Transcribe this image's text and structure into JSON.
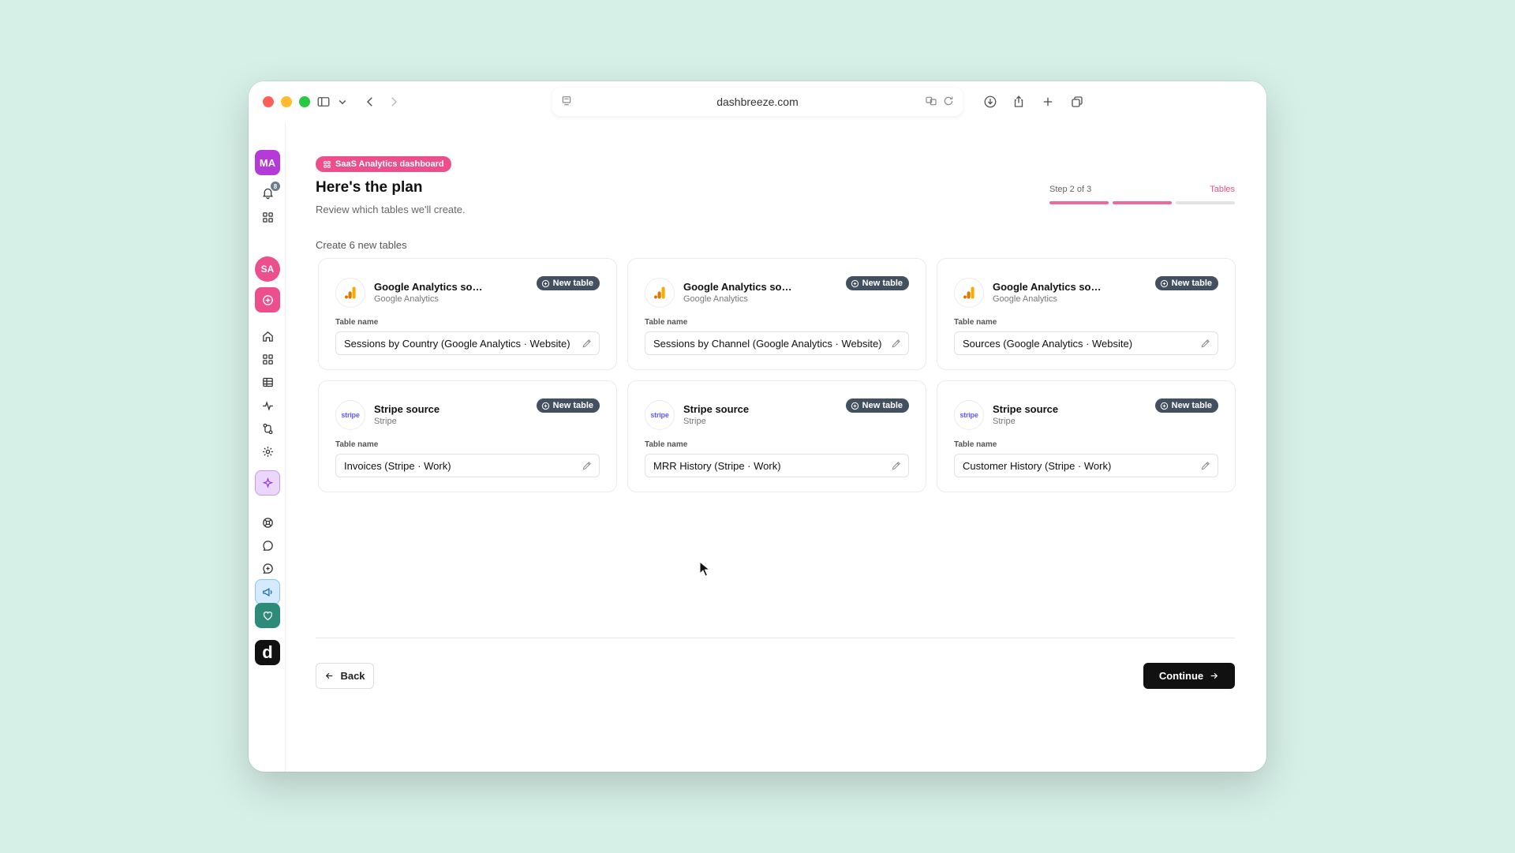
{
  "browser": {
    "url": "dashbreeze.com"
  },
  "sidebar": {
    "user_initials": "MA",
    "notification_count": "8",
    "workspace_initials": "SA",
    "logo_letter": "d"
  },
  "header": {
    "pill_label": "SaaS Analytics dashboard",
    "title": "Here's the plan",
    "subtitle": "Review which tables we'll create.",
    "step_text": "Step 2 of 3",
    "step_label": "Tables",
    "step_current": 2,
    "step_total": 3
  },
  "section_label": "Create 6 new tables",
  "cards": [
    {
      "source_title": "Google Analytics sour...",
      "source_type": "Google Analytics",
      "badge": "New table",
      "field_label": "Table name",
      "table_name": "Sessions by Country (Google Analytics · Website)",
      "logo": "google-analytics"
    },
    {
      "source_title": "Google Analytics sour...",
      "source_type": "Google Analytics",
      "badge": "New table",
      "field_label": "Table name",
      "table_name": "Sessions by Channel (Google Analytics · Website)",
      "logo": "google-analytics"
    },
    {
      "source_title": "Google Analytics sour...",
      "source_type": "Google Analytics",
      "badge": "New table",
      "field_label": "Table name",
      "table_name": "Sources (Google Analytics · Website)",
      "logo": "google-analytics"
    },
    {
      "source_title": "Stripe source",
      "source_type": "Stripe",
      "badge": "New table",
      "field_label": "Table name",
      "table_name": "Invoices (Stripe · Work)",
      "logo": "stripe",
      "logo_text": "stripe"
    },
    {
      "source_title": "Stripe source",
      "source_type": "Stripe",
      "badge": "New table",
      "field_label": "Table name",
      "table_name": "MRR History (Stripe · Work)",
      "logo": "stripe",
      "logo_text": "stripe"
    },
    {
      "source_title": "Stripe source",
      "source_type": "Stripe",
      "badge": "New table",
      "field_label": "Table name",
      "table_name": "Customer History (Stripe · Work)",
      "logo": "stripe",
      "logo_text": "stripe"
    }
  ],
  "footer": {
    "back_label": "Back",
    "continue_label": "Continue"
  },
  "colors": {
    "accent_pink": "#ec4f8c",
    "badge_dark": "#42505f",
    "primary_button": "#111111",
    "background": "#d6f0e8"
  }
}
